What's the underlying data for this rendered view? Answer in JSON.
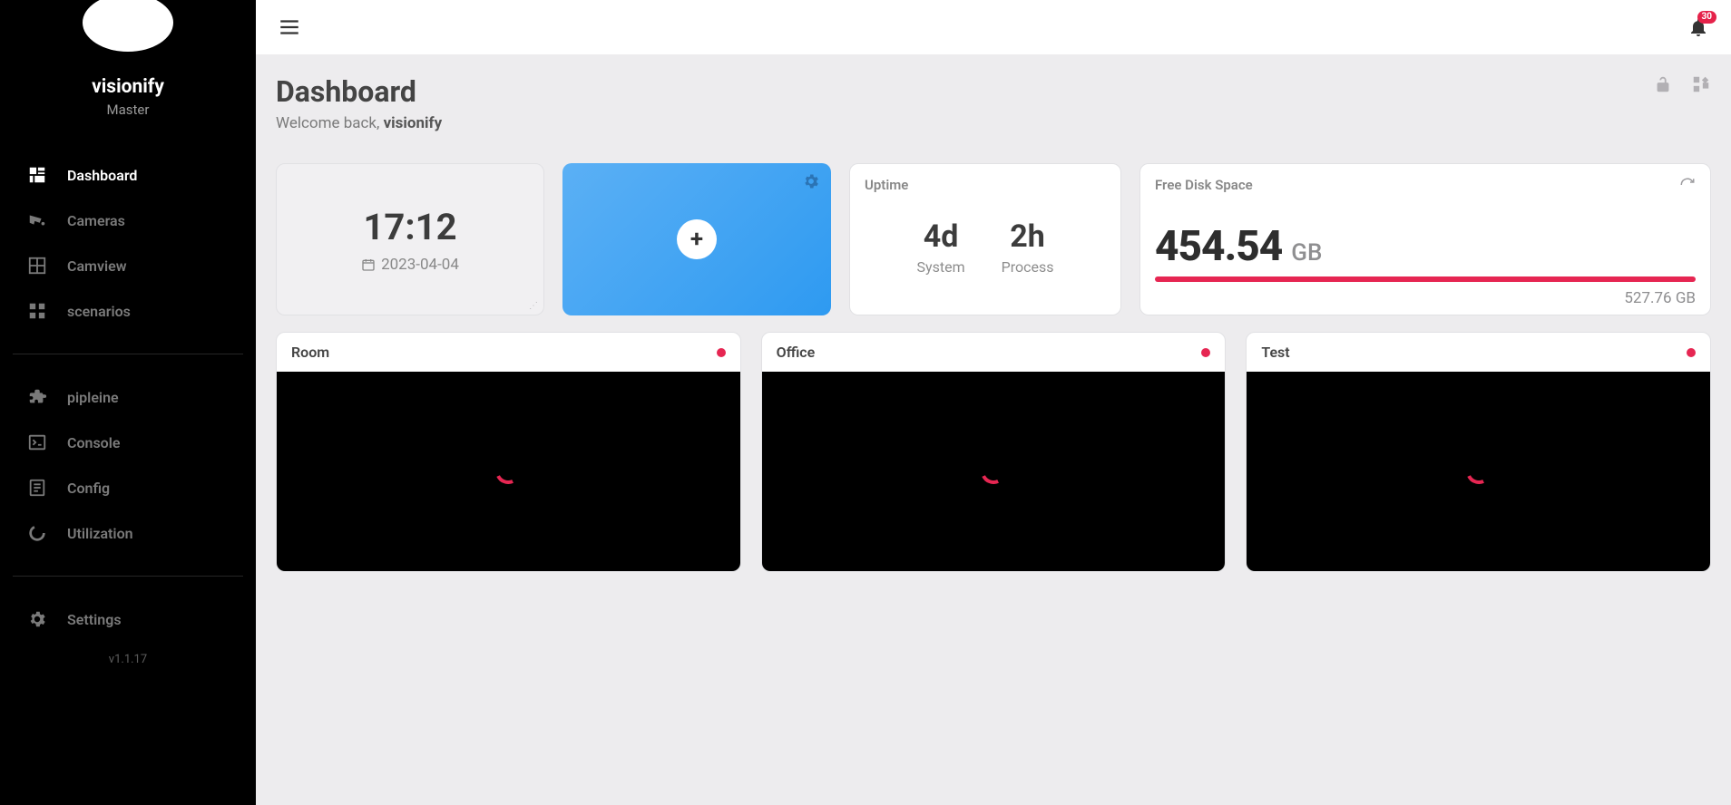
{
  "sidebar": {
    "brand": "visionify",
    "role": "Master",
    "groups": [
      [
        {
          "label": "Dashboard",
          "icon": "dashboard",
          "active": true,
          "name": "dashboard"
        },
        {
          "label": "Cameras",
          "icon": "camera",
          "active": false,
          "name": "cameras"
        },
        {
          "label": "Camview",
          "icon": "grid",
          "active": false,
          "name": "camview"
        },
        {
          "label": "scenarios",
          "icon": "widgets",
          "active": false,
          "name": "scenarios"
        }
      ],
      [
        {
          "label": "pipleine",
          "icon": "puzzle",
          "active": false,
          "name": "pipeline"
        },
        {
          "label": "Console",
          "icon": "terminal",
          "active": false,
          "name": "console"
        },
        {
          "label": "Config",
          "icon": "file",
          "active": false,
          "name": "config"
        },
        {
          "label": "Utilization",
          "icon": "donut",
          "active": false,
          "name": "utilization"
        }
      ],
      [
        {
          "label": "Settings",
          "icon": "gear",
          "active": false,
          "name": "settings"
        }
      ]
    ],
    "version": "v1.1.17"
  },
  "topbar": {
    "notifications": "30"
  },
  "header": {
    "title": "Dashboard",
    "welcome_prefix": "Welcome back, ",
    "welcome_name": "visionify"
  },
  "clock": {
    "time": "17:12",
    "date": "2023-04-04"
  },
  "uptime": {
    "title": "Uptime",
    "system_value": "4d",
    "system_label": "System",
    "process_value": "2h",
    "process_label": "Process"
  },
  "disk": {
    "title": "Free Disk Space",
    "free": "454.54",
    "unit": "GB",
    "total": "527.76 GB"
  },
  "cameras": [
    {
      "name": "Room"
    },
    {
      "name": "Office"
    },
    {
      "name": "Test"
    }
  ]
}
